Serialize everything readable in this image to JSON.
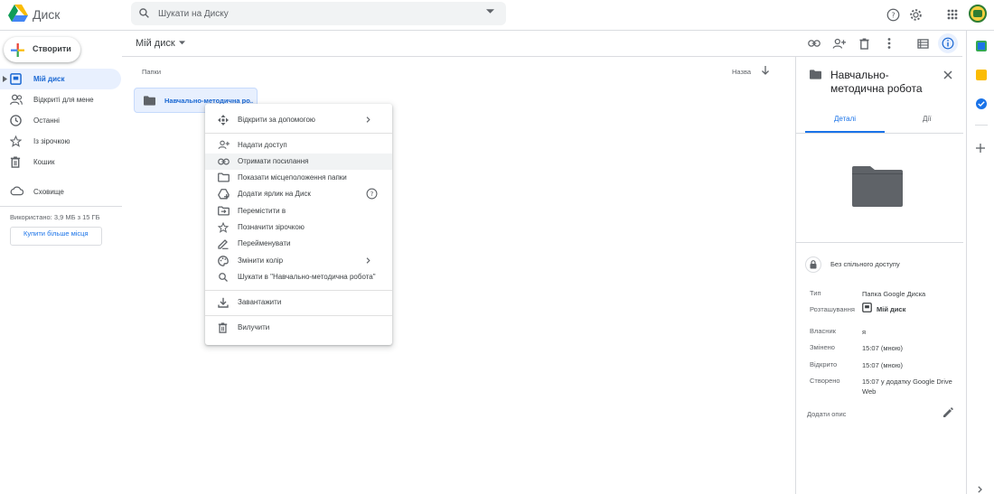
{
  "app": {
    "title": "Диск"
  },
  "search": {
    "placeholder": "Шукати на Диску"
  },
  "sidebar": {
    "new_label": "Створити",
    "items": [
      {
        "label": "Мій диск",
        "icon": "my-drive-icon",
        "active": true
      },
      {
        "label": "Відкриті для мене",
        "icon": "shared-with-me-icon"
      },
      {
        "label": "Останні",
        "icon": "clock-icon"
      },
      {
        "label": "Із зірочкою",
        "icon": "star-icon"
      },
      {
        "label": "Кошик",
        "icon": "trash-icon"
      },
      {
        "label": "Сховище",
        "icon": "cloud-icon"
      }
    ],
    "storage_text": "Використано: 3,9 МБ з 15 ГБ",
    "buy_label": "Купити більше місця"
  },
  "main": {
    "title": "Мій диск",
    "section_label": "Папки",
    "sort_label": "Назва",
    "folder_name": "Навчально-методична ро..."
  },
  "context_menu": {
    "items": [
      {
        "label": "Відкрити за допомогою",
        "icon": "open-with-icon",
        "submenu": true
      },
      {
        "label": "Надати доступ",
        "icon": "share-icon"
      },
      {
        "label": "Отримати посилання",
        "icon": "link-icon",
        "hover": true
      },
      {
        "label": "Показати місцеположення папки",
        "icon": "folder-outline-icon"
      },
      {
        "label": "Додати ярлик на Диск",
        "icon": "add-shortcut-icon",
        "help": true
      },
      {
        "label": "Перемістити в",
        "icon": "move-to-icon"
      },
      {
        "label": "Позначити зірочкою",
        "icon": "star-icon"
      },
      {
        "label": "Перейменувати",
        "icon": "rename-icon"
      },
      {
        "label": "Змінити колір",
        "icon": "palette-icon",
        "submenu": true
      },
      {
        "label": "Шукати в \"Навчально-методична робота\"",
        "icon": "search-icon"
      },
      {
        "label": "Завантажити",
        "icon": "download-icon"
      },
      {
        "label": "Вилучити",
        "icon": "trash-icon"
      }
    ]
  },
  "details": {
    "title": "Навчально-методична робота",
    "tab_details": "Деталі",
    "tab_activity": "Дії",
    "access": "Без спільного доступу",
    "props": [
      {
        "label": "Тип",
        "value": "Папка Google Диска"
      },
      {
        "label": "Розташування",
        "value": "Мій диск"
      },
      {
        "label": "Власник",
        "value": "я"
      },
      {
        "label": "Змінено",
        "value": "15:07 (мною)"
      },
      {
        "label": "Відкрито",
        "value": "15:07 (мною)"
      },
      {
        "label": "Створено",
        "value": "15:07 у додатку Google Drive Web"
      }
    ],
    "add_description": "Додати опис"
  },
  "colors": {
    "accent": "#1a73e8",
    "active_bg": "#e8f0fe",
    "folder": "#5f6368"
  }
}
